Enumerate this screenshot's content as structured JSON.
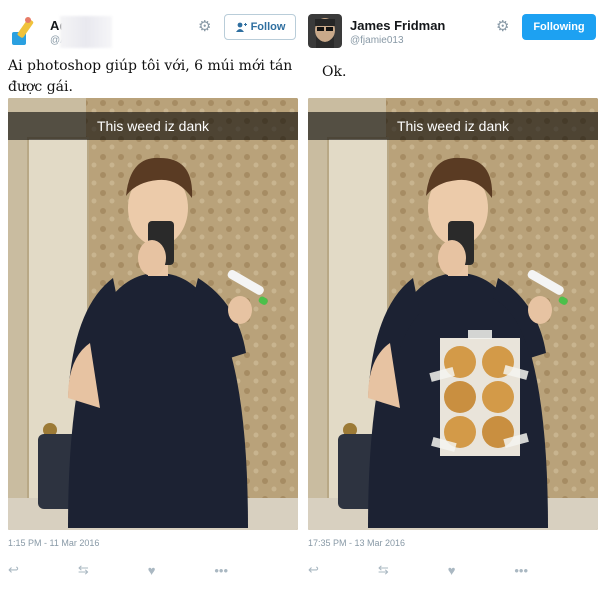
{
  "tweet_left": {
    "name": "Ad",
    "handle": "@A",
    "follow_label": "Follow",
    "text": "Ai photoshop giúp tôi với, 6 múi mới tán được gái.",
    "caption": "This weed iz dank",
    "timestamp": "1:15 PM - 11 Mar 2016",
    "icons": {
      "avatar": "pencil-user-avatar",
      "settings": "gear-icon",
      "follow": "add-user-icon"
    }
  },
  "tweet_right": {
    "name": "James Fridman",
    "handle": "@fjamie013",
    "following_label": "Following",
    "text": "Ok.",
    "caption": "This weed iz dank",
    "timestamp": "17:35 PM - 13 Mar 2016",
    "icons": {
      "avatar": "profile-photo-avatar",
      "settings": "gear-icon"
    }
  },
  "action_icons": [
    "reply-icon",
    "retweet-icon",
    "like-icon",
    "more-icon"
  ],
  "colors": {
    "follow_text": "#2f6fa0",
    "following_bg": "#1da1f2",
    "muted": "#8899a6"
  }
}
